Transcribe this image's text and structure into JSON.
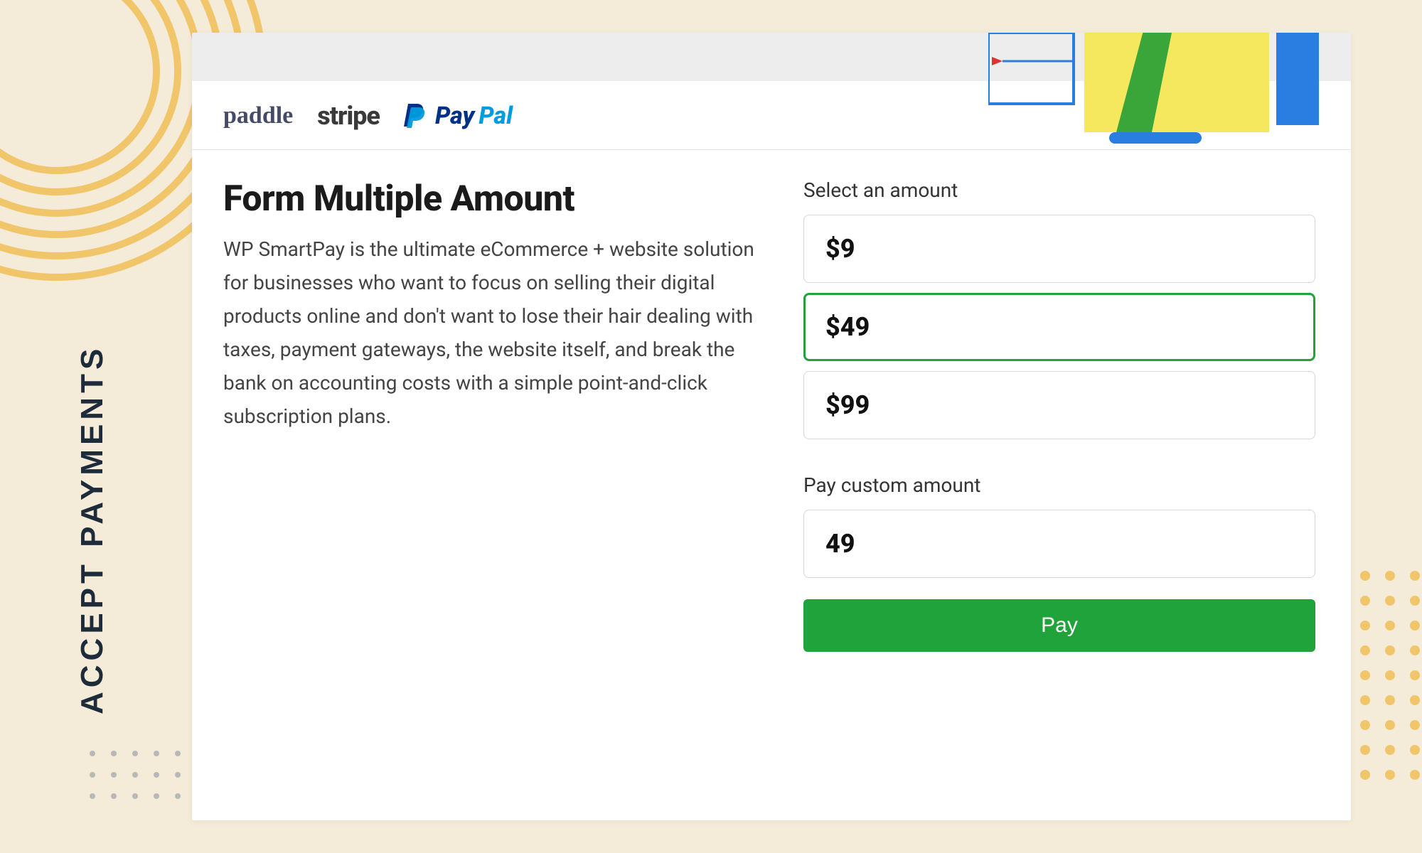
{
  "side_label": "ACCEPT PAYMENTS",
  "logos": {
    "paddle": "paddle",
    "stripe": "stripe",
    "paypal_pay": "Pay",
    "paypal_pal": "Pal"
  },
  "content": {
    "heading": "Form Multiple Amount",
    "description": "WP SmartPay is the ultimate eCommerce + website solution for businesses who want to focus on selling their digital products online and don't want to lose their hair dealing with taxes, payment gateways, the website itself, and break the bank on accounting costs with a simple point-and-click subscription plans."
  },
  "form": {
    "select_label": "Select an amount",
    "options": [
      "$9",
      "$49",
      "$99"
    ],
    "selected_index": 1,
    "custom_label": "Pay custom amount",
    "custom_value": "49",
    "pay_button": "Pay"
  },
  "colors": {
    "green": "#1fa33a",
    "ring": "#f1c56a"
  }
}
